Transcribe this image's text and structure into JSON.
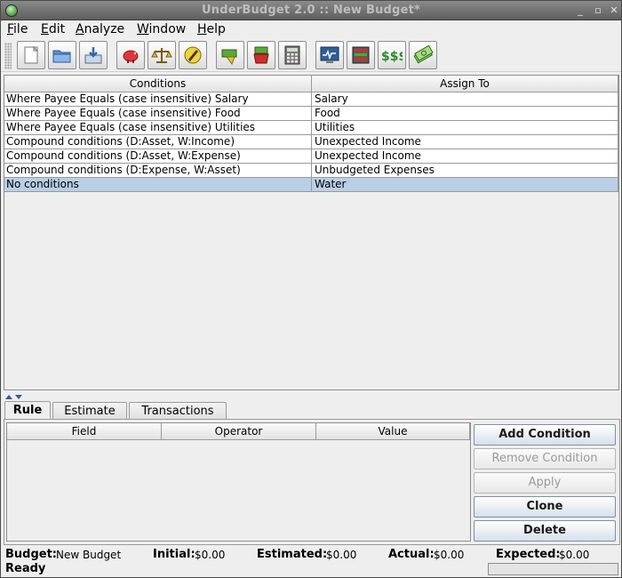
{
  "window": {
    "title": "UnderBudget 2.0 :: New Budget*"
  },
  "menu": [
    {
      "label": "File"
    },
    {
      "label": "Edit"
    },
    {
      "label": "Analyze"
    },
    {
      "label": "Window"
    },
    {
      "label": "Help"
    }
  ],
  "toolbar": {
    "icons": [
      "new-document-icon",
      "open-folder-icon",
      "save-disk-icon",
      "piggy-bank-icon",
      "balance-scale-icon",
      "pencil-circle-icon",
      "export-arrow-icon",
      "import-bucket-icon",
      "calculator-icon",
      "monitor-chart-icon",
      "ledger-stack-icon",
      "dollar-signs-icon",
      "banknotes-icon"
    ]
  },
  "rules": {
    "columns": [
      "Conditions",
      "Assign To"
    ],
    "rows": [
      {
        "conditions": "Where Payee Equals (case insensitive) Salary",
        "assign_to": "Salary"
      },
      {
        "conditions": "Where Payee Equals (case insensitive) Food",
        "assign_to": "Food"
      },
      {
        "conditions": "Where Payee Equals (case insensitive) Utilities",
        "assign_to": "Utilities"
      },
      {
        "conditions": "Compound conditions (D:Asset, W:Income)",
        "assign_to": "Unexpected Income"
      },
      {
        "conditions": "Compound conditions (D:Asset, W:Expense)",
        "assign_to": "Unexpected Income"
      },
      {
        "conditions": "Compound conditions (D:Expense, W:Asset)",
        "assign_to": "Unbudgeted Expenses"
      },
      {
        "conditions": "No conditions",
        "assign_to": "Water"
      }
    ],
    "selected_row": 6
  },
  "tabs": [
    {
      "label": "Rule"
    },
    {
      "label": "Estimate"
    },
    {
      "label": "Transactions"
    }
  ],
  "condition_table": {
    "columns": [
      "Field",
      "Operator",
      "Value"
    ]
  },
  "buttons": {
    "add_condition": "Add Condition",
    "remove_condition": "Remove Condition",
    "apply": "Apply",
    "clone": "Clone",
    "delete": "Delete"
  },
  "status": {
    "budget_label": "Budget:",
    "budget_value": "New Budget",
    "initial_label": "Initial:",
    "initial_value": "$0.00",
    "estimated_label": "Estimated:",
    "estimated_value": "$0.00",
    "actual_label": "Actual:",
    "actual_value": "$0.00",
    "expected_label": "Expected:",
    "expected_value": "$0.00",
    "ready": "Ready"
  }
}
